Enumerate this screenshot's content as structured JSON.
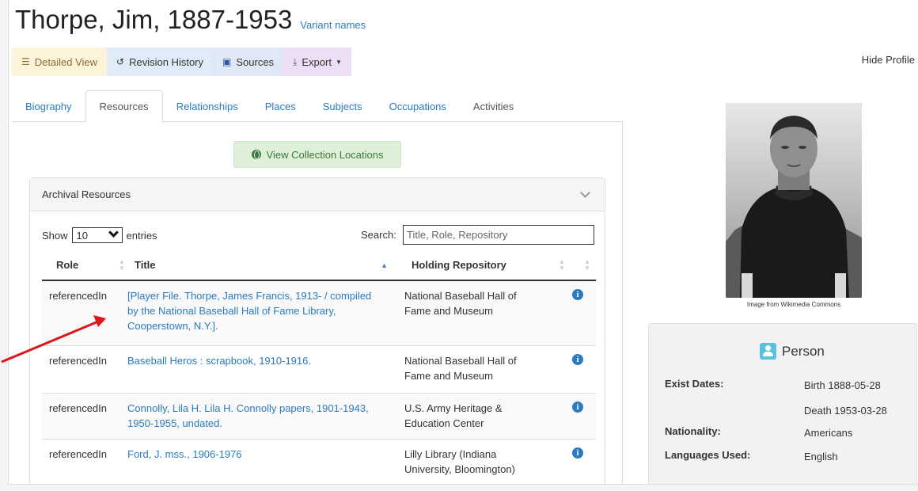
{
  "title": "Thorpe, Jim, 1887-1953",
  "variant_names_label": "Variant names",
  "toolbar": {
    "detailed_view": "Detailed View",
    "revision_history": "Revision History",
    "sources": "Sources",
    "export": "Export"
  },
  "hide_profile": "Hide Profile",
  "tabs": [
    {
      "label": "Biography"
    },
    {
      "label": "Resources"
    },
    {
      "label": "Relationships"
    },
    {
      "label": "Places"
    },
    {
      "label": "Subjects"
    },
    {
      "label": "Occupations"
    },
    {
      "label": "Activities"
    }
  ],
  "view_collection_locations": "View Collection Locations",
  "archival": {
    "panel_title": "Archival Resources",
    "show_label": "Show",
    "entries_select": "10",
    "entries_label": "entries",
    "search_label": "Search:",
    "search_placeholder": "Title, Role, Repository",
    "columns": {
      "role": "Role",
      "title": "Title",
      "repository": "Holding Repository"
    },
    "rows": [
      {
        "role": "referencedIn",
        "title": "[Player File. Thorpe, James Francis, 1913- / compiled by the National Baseball Hall of Fame Library, Cooperstown, N.Y.].",
        "repository": "National Baseball Hall of Fame and Museum"
      },
      {
        "role": "referencedIn",
        "title": "Baseball Heros : scrapbook, 1910-1916.",
        "repository": "National Baseball Hall of Fame and Museum"
      },
      {
        "role": "referencedIn",
        "title": "Connolly, Lila H. Lila H. Connolly papers, 1901-1943, 1950-1955, undated.",
        "repository": "U.S. Army Heritage & Education Center"
      },
      {
        "role": "referencedIn",
        "title": "Ford, J. mss., 1906-1976",
        "repository": "Lilly Library (Indiana University, Bloomington)"
      }
    ]
  },
  "photo_caption": "Image from Wikimedia Commons",
  "person": {
    "heading": "Person",
    "exist_dates_label": "Exist Dates:",
    "birth": "Birth 1888-05-28",
    "death": "Death 1953-03-28",
    "nationality_label": "Nationality:",
    "nationality": "Americans",
    "languages_label": "Languages Used:",
    "languages": "English"
  },
  "colors": {
    "link": "#2a7bbf",
    "annotation_arrow": "#e0141b",
    "person_icon": "#5bc0de",
    "view_locations_bg": "#dff0d8"
  }
}
